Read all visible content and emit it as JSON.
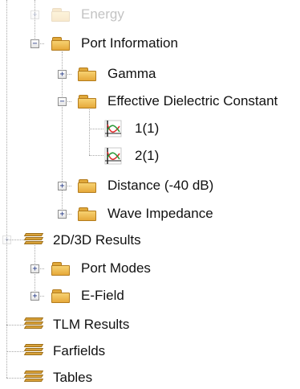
{
  "tree": {
    "energy": {
      "label": "Energy"
    },
    "port_information": {
      "label": "Port Information"
    },
    "gamma": {
      "label": "Gamma"
    },
    "effective_dielectric": {
      "label": "Effective Dielectric Constant"
    },
    "curve_1": {
      "label": "1(1)"
    },
    "curve_2": {
      "label": "2(1)"
    },
    "distance": {
      "label": "Distance (-40 dB)"
    },
    "wave_impedance": {
      "label": "Wave Impedance"
    },
    "results_2d3d": {
      "label": "2D/3D Results"
    },
    "port_modes": {
      "label": "Port Modes"
    },
    "e_field": {
      "label": "E-Field"
    },
    "tlm_results": {
      "label": "TLM Results"
    },
    "farfields": {
      "label": "Farfields"
    },
    "tables": {
      "label": "Tables"
    }
  },
  "icons": {
    "expand": "+",
    "collapse": "−"
  }
}
